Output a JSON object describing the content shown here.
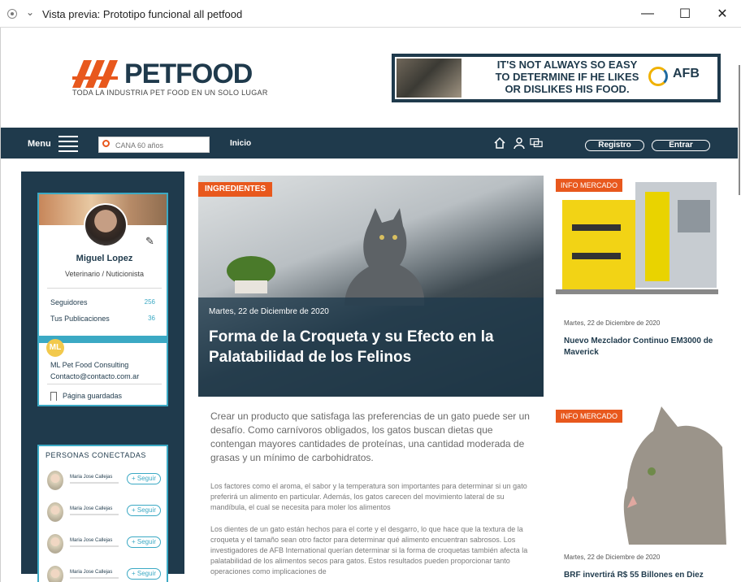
{
  "window": {
    "title": "Vista previa: Prototipo funcional all petfood",
    "minimize": "—",
    "maximize": "☐",
    "close": "✕",
    "chevron": "⌄"
  },
  "brand": {
    "name": "PETFOOD",
    "tagline": "TODA LA INDUSTRIA PET FOOD EN UN SOLO LUGAR",
    "accent": "#e8581d",
    "navy": "#1f3a4c",
    "teal": "#3ba9c4"
  },
  "banner": {
    "line1": "IT'S NOT ALWAYS SO EASY",
    "line2": "TO DETERMINE IF HE LIKES",
    "line3": "OR DISLIKES HIS FOOD.",
    "brand": "AFB"
  },
  "nav": {
    "menu_label": "Menu",
    "search_placeholder": "CANA 60 años",
    "inicio": "Inicio",
    "registro": "Registro",
    "entrar": "Entrar",
    "icons": [
      "home-icon",
      "user-icon",
      "chat-icon"
    ]
  },
  "profile": {
    "name": "Miguel Lopez",
    "role": "Veterinario / Nuticionista",
    "followers_label": "Seguidores",
    "followers": "256",
    "pubs_label": "Tus Publicaciones",
    "pubs": "36",
    "badge": "ML",
    "company": "ML Pet Food Consulting",
    "email": "Contacto@contacto.com.ar",
    "saved": "Página guardadas"
  },
  "people": {
    "heading": "PERSONAS CONECTADAS",
    "items": [
      {
        "name": "Maria Jose Callejas",
        "action": "+ Seguir"
      },
      {
        "name": "Maria Jose Callejas",
        "action": "+ Seguir"
      },
      {
        "name": "Maria Jose Callejas",
        "action": "+ Seguir"
      },
      {
        "name": "Maria Jose Callejas",
        "action": "+ Seguir"
      }
    ]
  },
  "hero": {
    "tag": "INGREDIENTES",
    "date": "Martes, 22 de Diciembre de 2020",
    "title": "Forma de la Croqueta y su Efecto en la Palatabilidad de los Felinos"
  },
  "article": {
    "intro": "Crear un producto que satisfaga las preferencias de un gato puede ser un desafío. Como carnívoros obligados, los gatos buscan dietas que contengan mayores cantidades de proteínas, una cantidad moderada de grasas y un mínimo de carbohidratos.",
    "p1": "Los factores como el aroma, el sabor y la temperatura son importantes para determinar si un gato preferirá un alimento en particular. Además, los gatos carecen del movimiento lateral de su mandíbula, el cual se necesita para moler los alimentos",
    "p2": "Los dientes de un gato están hechos para el corte y el desgarro, lo que hace que la textura de la croqueta y el tamaño sean otro factor para determinar qué alimento encuentran sabrosos. Los investigadores de AFB International querían determinar si la forma de croquetas también afecta la palatabilidad de los alimentos secos para gatos. Estos resultados pueden proporcionar tanto operaciones como implicaciones de"
  },
  "cards": [
    {
      "tag": "INFO MERCADO",
      "date": "Martes, 22 de Diciembre de 2020",
      "title": "Nuevo Mezclador Continuo EM3000 de Maverick"
    },
    {
      "tag": "INFO MERCADO",
      "date": "Martes, 22 de Diciembre de 2020",
      "title": "BRF invertirá R$ 55 Billones en Diez"
    }
  ]
}
